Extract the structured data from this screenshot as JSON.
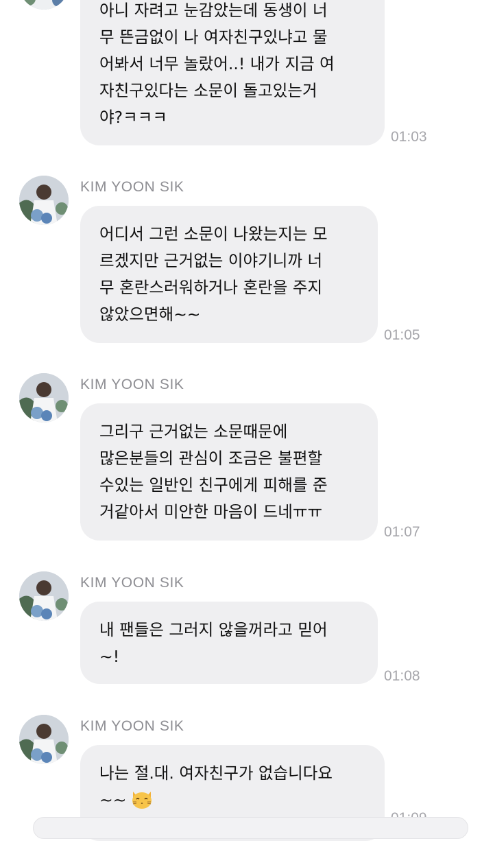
{
  "messages": [
    {
      "sender": "",
      "text": "아니 자려고 눈감았는데 동생이 너\n무 뜬금없이 나 여자친구있냐고 물\n어봐서 너무 놀랐어..! 내가 지금 여\n자친구있다는 소문이 돌고있는거\n야?ㅋㅋㅋ",
      "time": "01:03"
    },
    {
      "sender": "KIM YOON SIK",
      "text": "어디서 그런 소문이 나왔는지는 모\n르겠지만 근거없는 이야기니까 너\n무 혼란스러워하거나 혼란을 주지\n않았으면해~~",
      "time": "01:05"
    },
    {
      "sender": "KIM YOON SIK",
      "text": "그리구 근거없는 소문때문에\n많은분들의 관심이 조금은 불편할\n수있는 일반인 친구에게 피해를 준\n거같아서 미안한 마음이 드네ㅠㅠ",
      "time": "01:07"
    },
    {
      "sender": "KIM YOON SIK",
      "text": "내 팬들은 그러지 않을꺼라고 믿어\n~!",
      "time": "01:08"
    },
    {
      "sender": "KIM YOON SIK",
      "text": "나는 절.대. 여자친구가 없습니다요\n~~",
      "emoji": "kissing-cat-emoji",
      "time": "01:09"
    }
  ],
  "colors": {
    "bubble": "#efeff1",
    "sender": "#8e8e93",
    "time": "#a6a6ab",
    "text": "#111111"
  }
}
